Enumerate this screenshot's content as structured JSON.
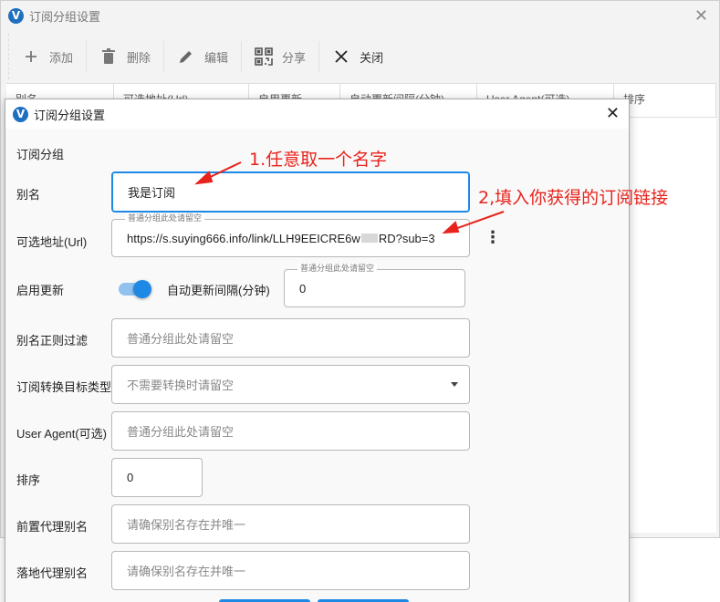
{
  "bg_window": {
    "title": "订阅分组设置",
    "toolbar": [
      {
        "icon": "plus-icon",
        "label": "添加"
      },
      {
        "icon": "trash-icon",
        "label": "删除"
      },
      {
        "icon": "edit-icon",
        "label": "编辑"
      },
      {
        "icon": "qrcode-icon",
        "label": "分享"
      },
      {
        "icon": "close-icon",
        "label": "关闭"
      }
    ],
    "columns": [
      "别名",
      "可选地址(Url)",
      "启用更新",
      "自动更新间隔(分钟)",
      "User Agent(可选)",
      "排序"
    ]
  },
  "dialog": {
    "title": "订阅分组设置",
    "section": "订阅分组",
    "fields": {
      "alias": {
        "label": "别名",
        "value": "我是订阅"
      },
      "url": {
        "label": "可选地址(Url)",
        "hint": "普通分组此处请留空",
        "value_prefix": "https://s.suying666.info/link/LLH9EEICRE6w",
        "value_suffix": "RD?sub=3"
      },
      "enable_update": {
        "label": "启用更新",
        "on": true
      },
      "interval": {
        "label": "自动更新间隔(分钟)",
        "hint": "普通分组此处请留空",
        "value": "0"
      },
      "filter": {
        "label": "别名正则过滤",
        "placeholder": "普通分组此处请留空"
      },
      "convert": {
        "label": "订阅转换目标类型",
        "placeholder": "不需要转换时请留空"
      },
      "user_agent": {
        "label": "User Agent(可选)",
        "placeholder": "普通分组此处请留空"
      },
      "sort": {
        "label": "排序",
        "value": "0"
      },
      "prev_proxy": {
        "label": "前置代理别名",
        "placeholder": "请确保别名存在并唯一"
      },
      "next_proxy": {
        "label": "落地代理别名",
        "placeholder": "请确保别名存在并唯一"
      }
    }
  },
  "annotations": {
    "note1": "1.任意取一个名字",
    "note2": "2,填入你获得的订阅链接",
    "color": "#e8231c"
  },
  "colors": {
    "accent": "#1e88e5"
  }
}
